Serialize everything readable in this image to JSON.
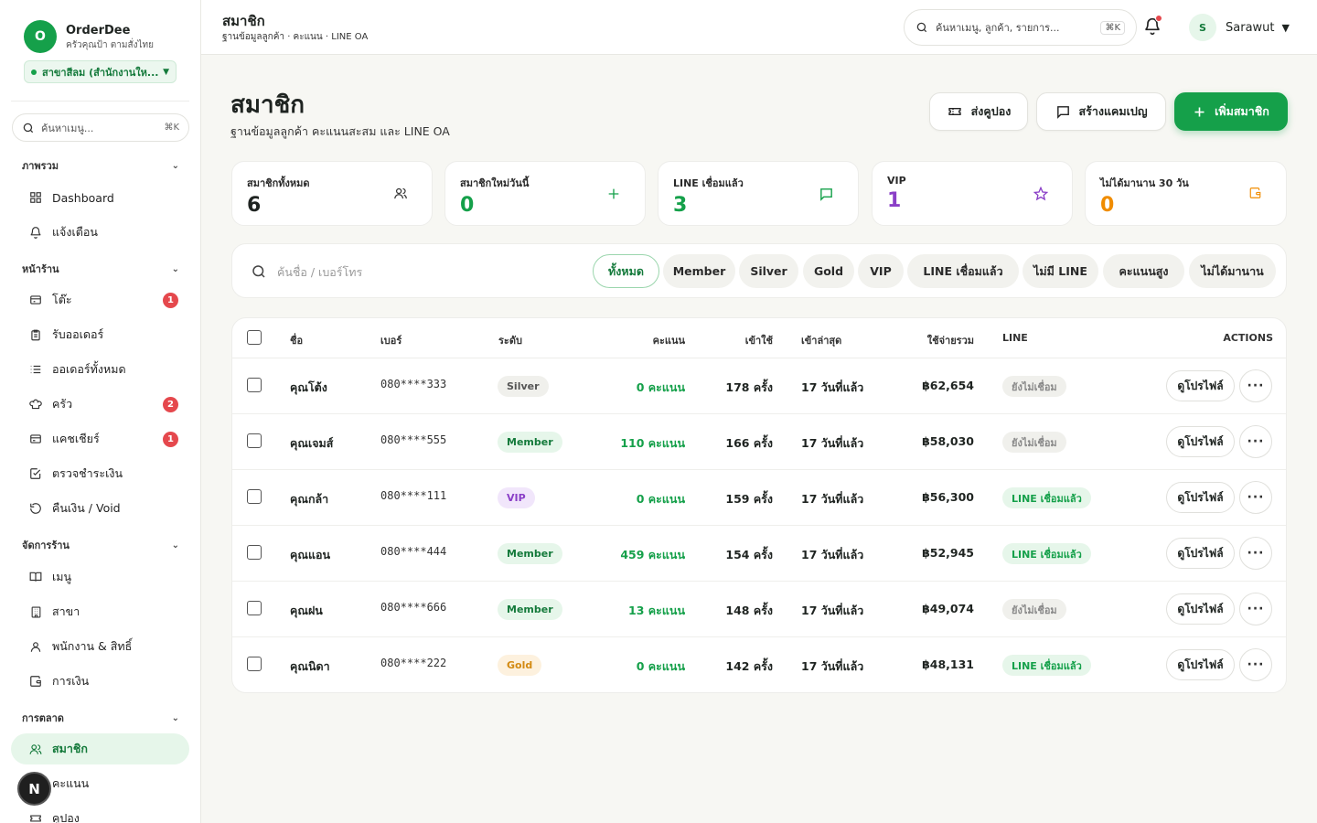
{
  "sidebar": {
    "brand_initial": "O",
    "brand_name": "OrderDee",
    "brand_sub": "ครัวคุณป้า ตามสั่งไทย",
    "branch": "สาขาสีลม (สำนักงานให...",
    "search_placeholder": "ค้นหาเมนู...",
    "search_kbd": "⌘K",
    "sections": [
      {
        "title": "ภาพรวม",
        "items": [
          {
            "label": "Dashboard",
            "icon": "grid-icon"
          },
          {
            "label": "แจ้งเตือน",
            "icon": "bell-icon"
          }
        ]
      },
      {
        "title": "หน้าร้าน",
        "items": [
          {
            "label": "โต๊ะ",
            "icon": "table-icon",
            "badge": "1"
          },
          {
            "label": "รับออเดอร์",
            "icon": "clipboard-icon"
          },
          {
            "label": "ออเดอร์ทั้งหมด",
            "icon": "list-icon"
          },
          {
            "label": "ครัว",
            "icon": "chef-hat-icon",
            "badge": "2"
          },
          {
            "label": "แคชเชียร์",
            "icon": "cashier-icon",
            "badge": "1"
          },
          {
            "label": "ตรวจชำระเงิน",
            "icon": "check-square-icon"
          },
          {
            "label": "คืนเงิน / Void",
            "icon": "refund-icon"
          }
        ]
      },
      {
        "title": "จัดการร้าน",
        "items": [
          {
            "label": "เมนู",
            "icon": "book-icon"
          },
          {
            "label": "สาขา",
            "icon": "building-icon"
          },
          {
            "label": "พนักงาน & สิทธิ์",
            "icon": "user-icon"
          },
          {
            "label": "การเงิน",
            "icon": "wallet-icon"
          }
        ]
      },
      {
        "title": "การตลาด",
        "items": [
          {
            "label": "สมาชิก",
            "icon": "users-icon",
            "active": true
          },
          {
            "label": "คะแนน",
            "icon": "star-icon"
          },
          {
            "label": "คูปอง",
            "icon": "ticket-icon"
          }
        ]
      }
    ],
    "fab": "N"
  },
  "topbar": {
    "title": "สมาชิก",
    "subtitle": "ฐานข้อมูลลูกค้า · คะแนน · LINE OA",
    "search_placeholder": "ค้นหาเมนู, ลูกค้า, รายการ...",
    "search_kbd": "⌘K",
    "user_initial": "S",
    "user_name": "Sarawut"
  },
  "page": {
    "title": "สมาชิก",
    "subtitle": "ฐานข้อมูลลูกค้า คะแนนสะสม และ LINE OA",
    "buttons": {
      "coupon": "ส่งคูปอง",
      "campaign": "สร้างแคมเปญ",
      "add": "เพิ่มสมาชิก"
    }
  },
  "stats": [
    {
      "label": "สมาชิกทั้งหมด",
      "value": "6",
      "color": "#1f2421",
      "icon": "users-icon"
    },
    {
      "label": "สมาชิกใหม่วันนี้",
      "value": "0",
      "color": "#15a04a",
      "icon": "plus-icon"
    },
    {
      "label": "LINE เชื่อมแล้ว",
      "value": "3",
      "color": "#15a04a",
      "icon": "chat-icon"
    },
    {
      "label": "VIP",
      "value": "1",
      "color": "#8a3fc7",
      "icon": "star-icon"
    },
    {
      "label": "ไม่ได้มานาน 30 วัน",
      "value": "0",
      "color": "#f08c00",
      "icon": "wallet-icon"
    }
  ],
  "filter": {
    "placeholder": "ค้นชื่อ / เบอร์โทร",
    "chips": [
      "ทั้งหมด",
      "Member",
      "Silver",
      "Gold",
      "VIP",
      "LINE เชื่อมแล้ว",
      "ไม่มี LINE",
      "คะแนนสูง",
      "ไม่ได้มานาน"
    ],
    "active": "ทั้งหมด"
  },
  "table": {
    "headers": {
      "name": "ชื่อ",
      "phone": "เบอร์",
      "tier": "ระดับ",
      "points": "คะแนน",
      "visits": "เข้าใช้",
      "last": "เข้าล่าสุด",
      "spend": "ใช้จ่ายรวม",
      "line": "LINE",
      "actions": "ACTIONS"
    },
    "profile_label": "ดูโปรไฟล์",
    "more_label": "···",
    "rows": [
      {
        "name": "คุณโต้ง",
        "phone": "080****333",
        "tier": "Silver",
        "points": "0 คะแนน",
        "visits": "178 ครั้ง",
        "last": "17 วันที่แล้ว",
        "spend": "฿62,654",
        "line": "ยังไม่เชื่อม",
        "line_on": false
      },
      {
        "name": "คุณเจมส์",
        "phone": "080****555",
        "tier": "Member",
        "points": "110 คะแนน",
        "visits": "166 ครั้ง",
        "last": "17 วันที่แล้ว",
        "spend": "฿58,030",
        "line": "ยังไม่เชื่อม",
        "line_on": false
      },
      {
        "name": "คุณกล้า",
        "phone": "080****111",
        "tier": "VIP",
        "points": "0 คะแนน",
        "visits": "159 ครั้ง",
        "last": "17 วันที่แล้ว",
        "spend": "฿56,300",
        "line": "LINE เชื่อมแล้ว",
        "line_on": true
      },
      {
        "name": "คุณแอน",
        "phone": "080****444",
        "tier": "Member",
        "points": "459 คะแนน",
        "visits": "154 ครั้ง",
        "last": "17 วันที่แล้ว",
        "spend": "฿52,945",
        "line": "LINE เชื่อมแล้ว",
        "line_on": true
      },
      {
        "name": "คุณฝน",
        "phone": "080****666",
        "tier": "Member",
        "points": "13 คะแนน",
        "visits": "148 ครั้ง",
        "last": "17 วันที่แล้ว",
        "spend": "฿49,074",
        "line": "ยังไม่เชื่อม",
        "line_on": false
      },
      {
        "name": "คุณนิดา",
        "phone": "080****222",
        "tier": "Gold",
        "points": "0 คะแนน",
        "visits": "142 ครั้ง",
        "last": "17 วันที่แล้ว",
        "spend": "฿48,131",
        "line": "LINE เชื่อมแล้ว",
        "line_on": true
      }
    ]
  },
  "colors": {
    "accent": "#15a04a",
    "tier_member": "#e6f6ea",
    "tier_silver": "#f0f0ec",
    "tier_gold": "#fdf1de",
    "tier_vip": "#f1e6fb"
  }
}
